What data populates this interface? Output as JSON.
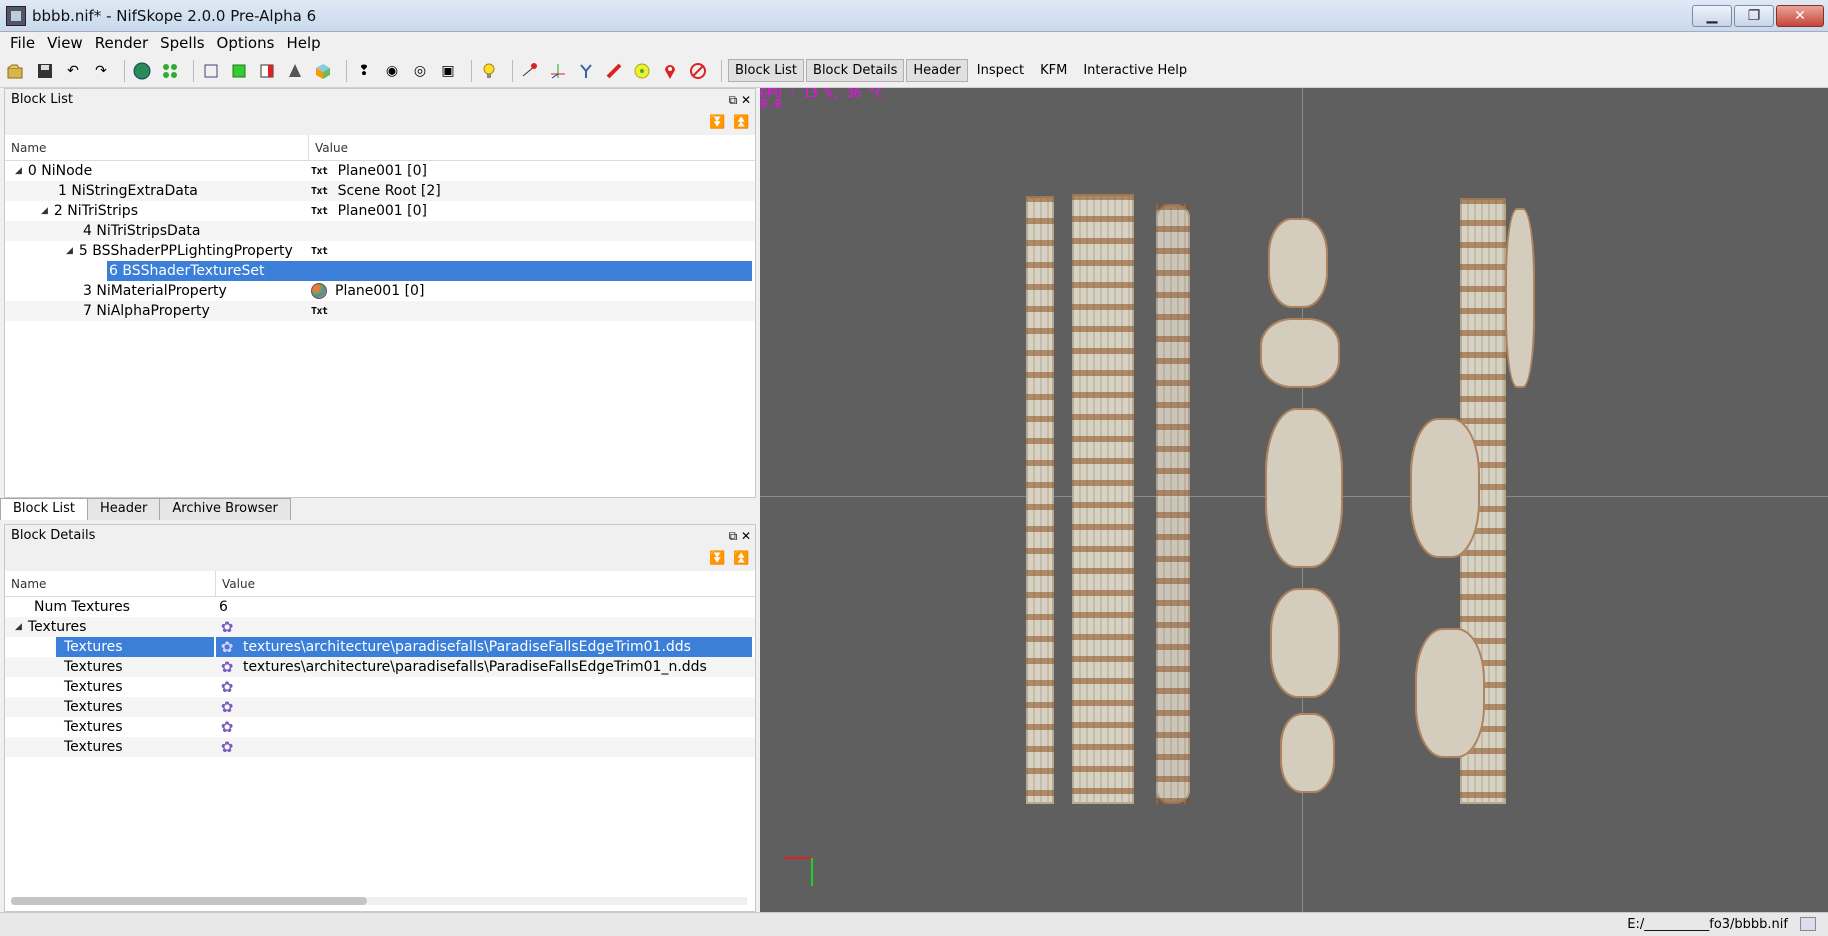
{
  "window": {
    "title": "bbbb.nif* - NifSkope 2.0.0 Pre-Alpha 6",
    "min": "▁",
    "max": "❐",
    "close": "✕"
  },
  "menu": [
    "File",
    "View",
    "Render",
    "Spells",
    "Options",
    "Help"
  ],
  "toolbar": {
    "tabs": [
      "Block List",
      "Block Details",
      "Header",
      "Inspect",
      "KFM",
      "Interactive Help"
    ]
  },
  "block_list": {
    "title": "Block List",
    "col_name": "Name",
    "col_value": "Value",
    "rows": [
      {
        "label": "0 NiNode",
        "arrow": "◢",
        "badge": "Txt",
        "value": "Plane001 [0]"
      },
      {
        "label": "1 NiStringExtraData",
        "arrow": "",
        "badge": "Txt",
        "value": "Scene Root [2]"
      },
      {
        "label": "2 NiTriStrips",
        "arrow": "◢",
        "badge": "Txt",
        "value": "Plane001 [0]"
      },
      {
        "label": "4 NiTriStripsData",
        "arrow": "",
        "badge": "",
        "value": ""
      },
      {
        "label": "5 BSShaderPPLightingProperty",
        "arrow": "◢",
        "badge": "Txt",
        "value": ""
      },
      {
        "label": "6 BSShaderTextureSet",
        "arrow": "",
        "badge": "",
        "value": ""
      },
      {
        "label": "3 NiMaterialProperty",
        "arrow": "",
        "badge": "",
        "value": "Plane001 [0]"
      },
      {
        "label": "7 NiAlphaProperty",
        "arrow": "",
        "badge": "Txt",
        "value": ""
      }
    ]
  },
  "bottom_tabs": [
    "Block List",
    "Header",
    "Archive Browser"
  ],
  "block_details": {
    "title": "Block Details",
    "col_name": "Name",
    "col_value": "Value",
    "rows": [
      {
        "label": "Num Textures",
        "arrow": "",
        "value": "6"
      },
      {
        "label": "Textures",
        "arrow": "◢",
        "value": ""
      },
      {
        "label": "Textures",
        "arrow": "",
        "value": "textures\\architecture\\paradisefalls\\ParadiseFallsEdgeTrim01.dds"
      },
      {
        "label": "Textures",
        "arrow": "",
        "value": "textures\\architecture\\paradisefalls\\ParadiseFallsEdgeTrim01_n.dds"
      },
      {
        "label": "Textures",
        "arrow": "",
        "value": ""
      },
      {
        "label": "Textures",
        "arrow": "",
        "value": ""
      },
      {
        "label": "Textures",
        "arrow": "",
        "value": ""
      },
      {
        "label": "Textures",
        "arrow": "",
        "value": ""
      }
    ]
  },
  "viewport": {
    "gpu_line1": "GPU  : 13 %, 36 °C",
    "gpu_line2": "0.0"
  },
  "status": {
    "path": "E:/__________fo3/bbbb.nif"
  }
}
